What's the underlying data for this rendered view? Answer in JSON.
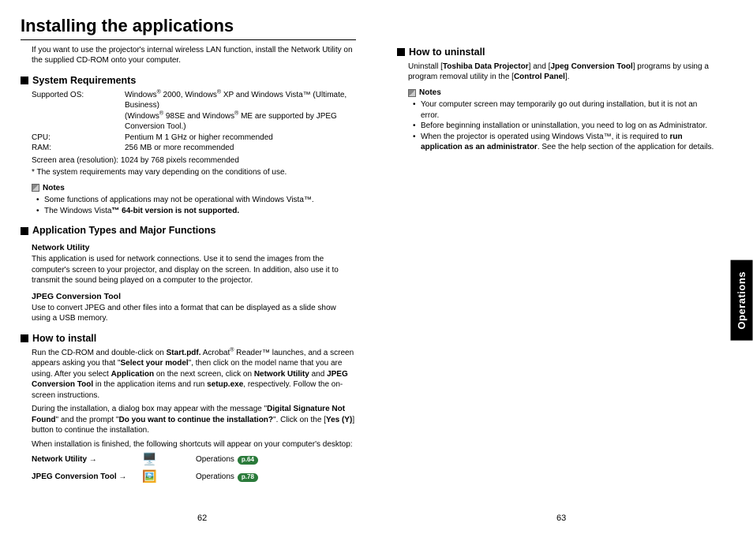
{
  "title": "Installing the applications",
  "intro": "If you want to use the projector's internal wireless LAN function, install the Network Utility on the supplied CD-ROM onto your computer.",
  "sysreq": {
    "heading": "System Requirements",
    "os_label": "Supported OS:",
    "os_val1_a": "Windows",
    "os_val1_b": " 2000, Windows",
    "os_val1_c": " XP and Windows Vista™ (Ultimate, Business)",
    "os_val2_a": "(Windows",
    "os_val2_b": " 98SE and Windows",
    "os_val2_c": " ME are supported by JPEG Conversion Tool.)",
    "cpu_label": "CPU:",
    "cpu_val": "Pentium M 1 GHz or higher recommended",
    "ram_label": "RAM:",
    "ram_val": "256 MB or more recommended",
    "screen": "Screen area (resolution):  1024 by 768 pixels recommended",
    "footnote": "* The system requirements may vary depending on the conditions of use.",
    "notes_heading": "Notes",
    "notes": [
      "Some functions of applications may not be operational with Windows Vista™.",
      "The Windows Vista™ 64-bit version is not supported."
    ]
  },
  "apptypes": {
    "heading": "Application Types and Major Functions",
    "nu_title": "Network Utility",
    "nu_body": "This application is used for network connections. Use it to send the images from the computer's screen to your projector, and display on the screen. In addition, also use it to transmit the sound being played on a computer to the projector.",
    "jc_title": "JPEG Conversion Tool",
    "jc_body": "Use to convert JPEG and other files into a format that can be displayed as a slide show using a USB memory."
  },
  "install": {
    "heading": "How to install",
    "p1_a": "Run the CD-ROM and double-click on ",
    "p1_b": "Start.pdf.",
    "p1_c": " Acrobat",
    "p1_d": " Reader™ launches, and a screen appears asking you that \"",
    "p1_e": "Select your model",
    "p1_f": "\", then click on the model name that you are using. After you select ",
    "p1_g": "Application",
    "p1_h": " on the next screen, click on ",
    "p1_i": "Network Utility",
    "p1_j": " and ",
    "p1_k": "JPEG Conversion Tool",
    "p1_l": " in the application items and run ",
    "p1_m": "setup.exe",
    "p1_n": ", respectively. Follow the on-screen instructions.",
    "p2_a": "During the installation, a dialog box may appear with the message \"",
    "p2_b": "Digital Signature Not Found",
    "p2_c": "\" and the prompt \"",
    "p2_d": "Do you want to continue the installation?",
    "p2_e": "\". Click on the [",
    "p2_f": "Yes (Y)",
    "p2_g": "] button to continue the installation.",
    "p3": "When installation is finished, the following shortcuts will appear on your computer's desktop:",
    "sc1_label": "Network Utility →",
    "sc2_label": "JPEG Conversion Tool →",
    "op_text": "Operations",
    "pill1": "p.64",
    "pill2": "p.78"
  },
  "uninstall": {
    "heading": "How to uninstall",
    "body_a": "Uninstall [",
    "body_b": "Toshiba Data Projector",
    "body_c": "] and [",
    "body_d": "Jpeg Conversion Tool",
    "body_e": "] programs by using a program removal utility in the [",
    "body_f": "Control Panel",
    "body_g": "].",
    "notes_heading": "Notes",
    "n1": "Your computer screen may temporarily go out during installation, but it is not an error.",
    "n2": "Before beginning installation or uninstallation, you need to log on as Administrator.",
    "n3_a": "When the projector is operated using Windows Vista™, it is required to ",
    "n3_b": "run application as an administrator",
    "n3_c": ". See the help section of the application for details."
  },
  "tab": "Operations",
  "page_left": "62",
  "page_right": "63"
}
